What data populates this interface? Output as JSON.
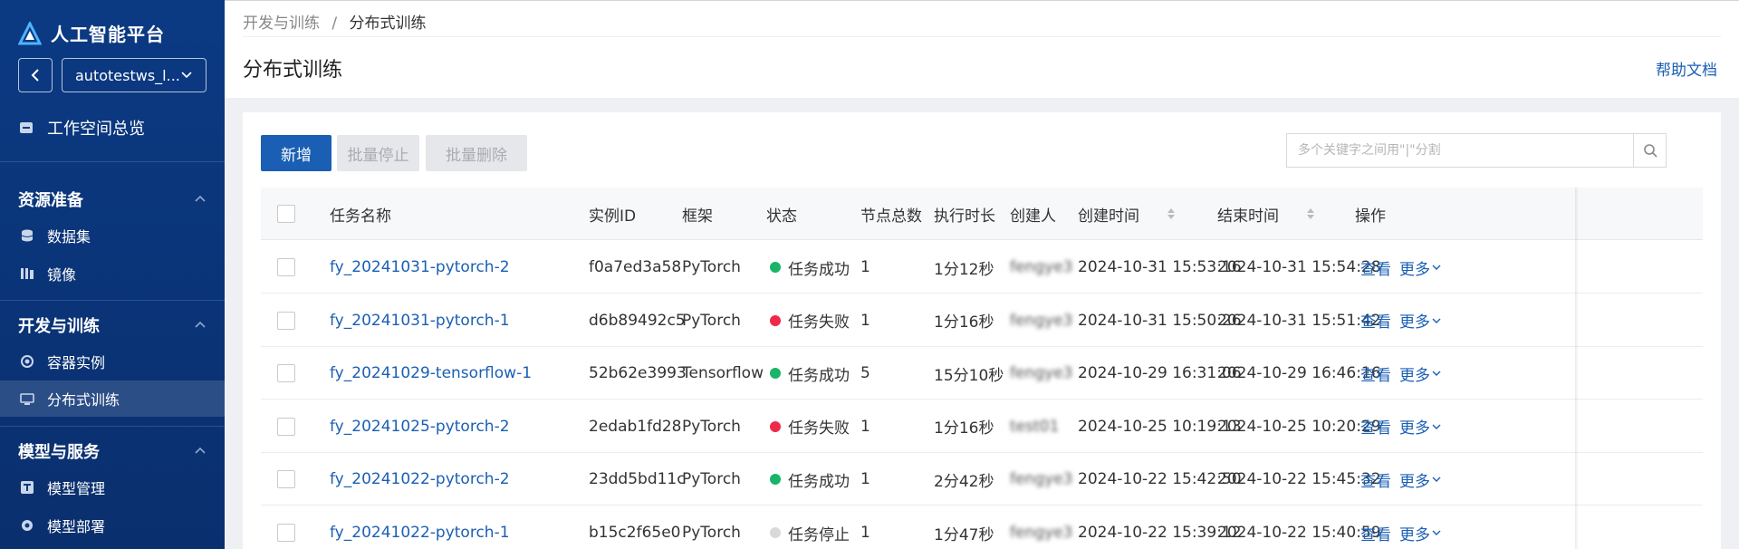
{
  "app": {
    "title": "人工智能平台"
  },
  "workspace": {
    "name": "autotestws_l..."
  },
  "nav": {
    "overview": "工作空间总览",
    "sections": [
      {
        "title": "资源准备",
        "items": [
          "数据集",
          "镜像"
        ]
      },
      {
        "title": "开发与训练",
        "items": [
          "容器实例",
          "分布式训练"
        ]
      },
      {
        "title": "模型与服务",
        "items": [
          "模型管理",
          "模型部署"
        ]
      }
    ],
    "active": "分布式训练"
  },
  "breadcrumb": {
    "parent": "开发与训练",
    "sep": "/",
    "current": "分布式训练"
  },
  "page": {
    "title": "分布式训练",
    "help": "帮助文档"
  },
  "toolbar": {
    "add": "新增",
    "batch_stop": "批量停止",
    "batch_delete": "批量删除"
  },
  "search": {
    "placeholder": "多个关键字之间用\"|\"分割"
  },
  "colors": {
    "success": "#18b566",
    "failed": "#f0284a",
    "stopped": "#d9d9d9",
    "accent": "#1a5fb4"
  },
  "table": {
    "headers": {
      "name": "任务名称",
      "instance_id": "实例ID",
      "framework": "框架",
      "status": "状态",
      "nodes": "节点总数",
      "duration": "执行时长",
      "creator": "创建人",
      "created": "创建时间",
      "ended": "结束时间",
      "ops": "操作"
    },
    "view_label": "查看",
    "more_label": "更多",
    "rows": [
      {
        "name": "fy_20241031-pytorch-2",
        "instance_id": "f0a7ed3a58",
        "framework": "PyTorch",
        "status": "任务成功",
        "status_type": "success",
        "nodes": "1",
        "duration": "1分12秒",
        "creator": "fengye3",
        "created": "2024-10-31 15:53:16",
        "ended": "2024-10-31 15:54:28"
      },
      {
        "name": "fy_20241031-pytorch-1",
        "instance_id": "d6b89492c5",
        "framework": "PyTorch",
        "status": "任务失败",
        "status_type": "failed",
        "nodes": "1",
        "duration": "1分16秒",
        "creator": "fengye3",
        "created": "2024-10-31 15:50:26",
        "ended": "2024-10-31 15:51:42"
      },
      {
        "name": "fy_20241029-tensorflow-1",
        "instance_id": "52b62e3993",
        "framework": "Tensorflow",
        "status": "任务成功",
        "status_type": "success",
        "nodes": "5",
        "duration": "15分10秒",
        "creator": "fengye3",
        "created": "2024-10-29 16:31:06",
        "ended": "2024-10-29 16:46:16"
      },
      {
        "name": "fy_20241025-pytorch-2",
        "instance_id": "2edab1fd28",
        "framework": "PyTorch",
        "status": "任务失败",
        "status_type": "failed",
        "nodes": "1",
        "duration": "1分16秒",
        "creator": "test01",
        "created": "2024-10-25 10:19:13",
        "ended": "2024-10-25 10:20:29"
      },
      {
        "name": "fy_20241022-pytorch-2",
        "instance_id": "23dd5bd11c",
        "framework": "PyTorch",
        "status": "任务成功",
        "status_type": "success",
        "nodes": "1",
        "duration": "2分42秒",
        "creator": "fengye3",
        "created": "2024-10-22 15:42:50",
        "ended": "2024-10-22 15:45:32"
      },
      {
        "name": "fy_20241022-pytorch-1",
        "instance_id": "b15c2f65e0",
        "framework": "PyTorch",
        "status": "任务停止",
        "status_type": "stopped",
        "nodes": "1",
        "duration": "1分47秒",
        "creator": "fengye3",
        "created": "2024-10-22 15:39:12",
        "ended": "2024-10-22 15:40:59"
      }
    ]
  }
}
